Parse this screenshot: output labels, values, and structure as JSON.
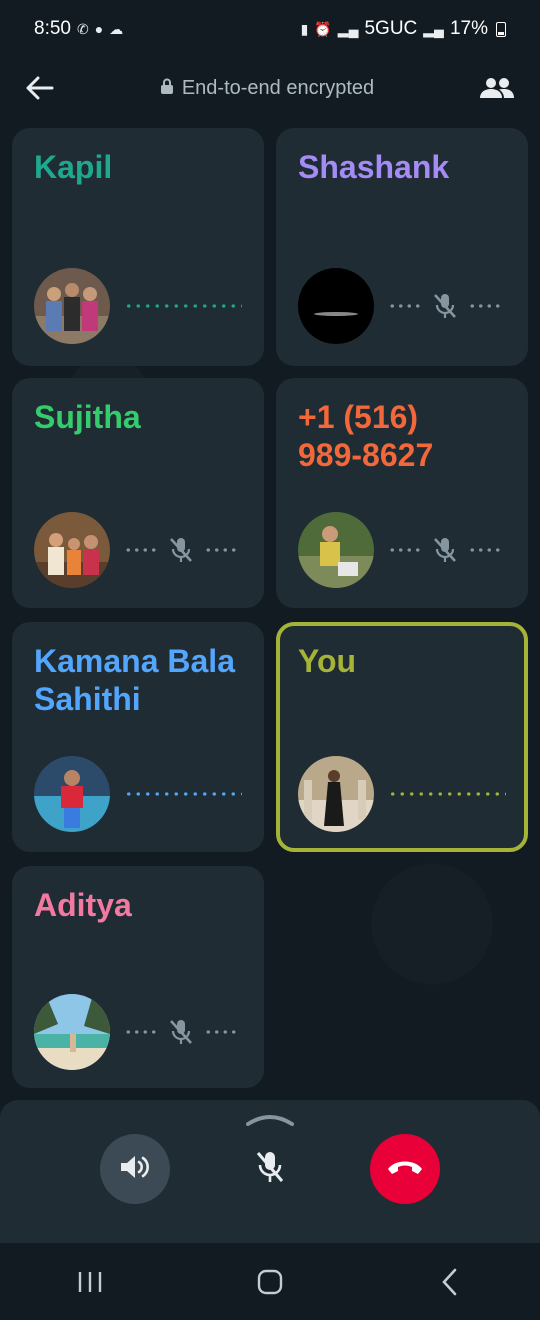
{
  "status_bar": {
    "time": "8:50",
    "network": "5GUC",
    "battery": "17%"
  },
  "header": {
    "encryption_label": "End-to-end encrypted"
  },
  "participants": [
    {
      "name": "Kapil",
      "color": "#1fa88e",
      "status": "speaking",
      "avatar": "group-photo"
    },
    {
      "name": "Shashank",
      "color": "#a48bf5",
      "status": "muted",
      "avatar": "dark-photo"
    },
    {
      "name": "Sujitha",
      "color": "#35cd6b",
      "status": "muted",
      "avatar": "group-photo"
    },
    {
      "name": "+1 (516) 989-8627",
      "color": "#f2683b",
      "status": "muted",
      "avatar": "outdoor-photo"
    },
    {
      "name": "Kamana Bala Sahithi",
      "color": "#53a6fd",
      "status": "speaking",
      "avatar": "pool-photo"
    },
    {
      "name": "You",
      "color": "#a5b337",
      "status": "speaking",
      "avatar": "person-photo",
      "active_speaker": true
    },
    {
      "name": "Aditya",
      "color": "#f379a1",
      "status": "muted",
      "avatar": "beach-photo"
    }
  ],
  "controls": {
    "speaker": "speaker-icon",
    "mute": "mic-off-icon",
    "end_call": "end-call-icon",
    "end_call_color": "#ea0038"
  }
}
